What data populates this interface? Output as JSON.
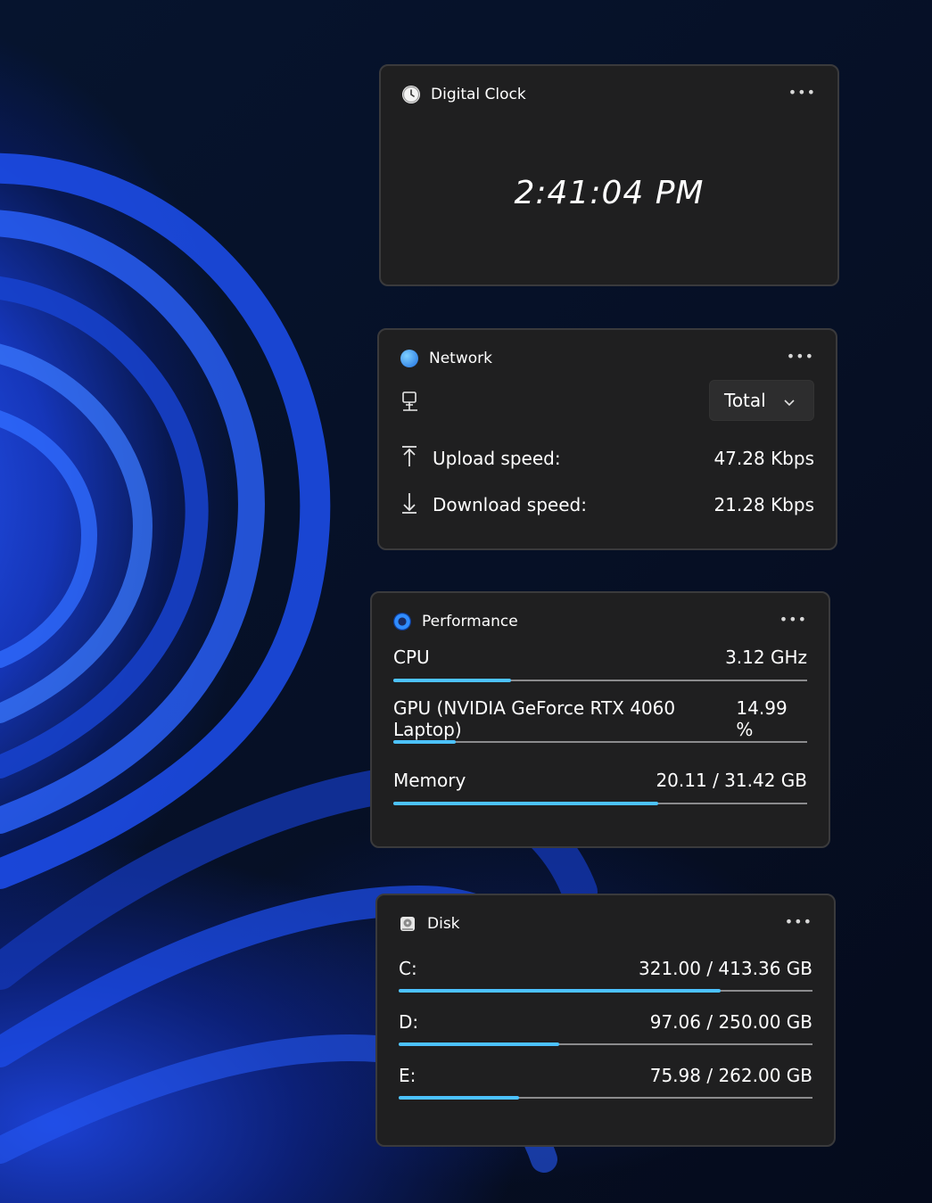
{
  "clock": {
    "title": "Digital Clock",
    "time": "2:41:04 PM",
    "icon": "clock-icon"
  },
  "network": {
    "title": "Network",
    "icon": "network-globe-icon",
    "adapter_icon": "computer-network-icon",
    "selected": "Total",
    "upload_label": "Upload speed:",
    "upload_value": "47.28 Kbps",
    "download_label": "Download speed:",
    "download_value": "21.28 Kbps"
  },
  "performance": {
    "title": "Performance",
    "icon": "performance-gauge-icon",
    "items": [
      {
        "label": "CPU",
        "value": "3.12 GHz",
        "fill": 0.285
      },
      {
        "label": "GPU (NVIDIA GeForce RTX 4060 Laptop)",
        "value": "14.99 %",
        "fill": 0.15
      },
      {
        "label": "Memory",
        "value": "20.11 / 31.42 GB",
        "fill": 0.64
      }
    ]
  },
  "disk": {
    "title": "Disk",
    "icon": "disk-drive-icon",
    "items": [
      {
        "label": "C:",
        "value": "321.00 / 413.36 GB",
        "fill": 0.777
      },
      {
        "label": "D:",
        "value": "97.06 / 250.00 GB",
        "fill": 0.388
      },
      {
        "label": "E:",
        "value": "75.98 / 262.00 GB",
        "fill": 0.29
      }
    ]
  },
  "more_label": "•••",
  "colors": {
    "accent": "#4cc2ff",
    "widget_bg": "#1f1f20",
    "track": "#8b8b8d"
  }
}
